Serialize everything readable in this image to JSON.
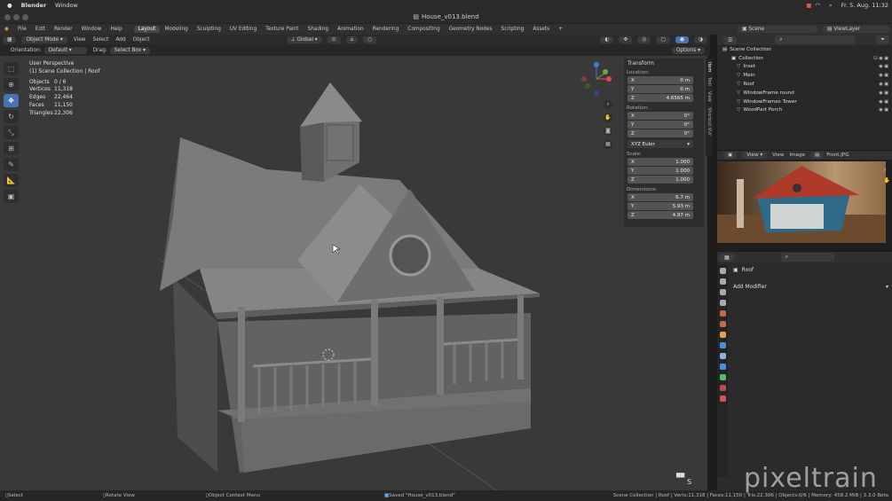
{
  "mac": {
    "app": "Blender",
    "menu_window": "Window",
    "date_time": "Fr. 5. Aug. 11:32"
  },
  "window": {
    "title": "House_v013.blend"
  },
  "menubar": {
    "items": [
      "File",
      "Edit",
      "Render",
      "Window",
      "Help"
    ],
    "tabs": [
      "Layout",
      "Modeling",
      "Sculpting",
      "UV Editing",
      "Texture Paint",
      "Shading",
      "Animation",
      "Rendering",
      "Compositing",
      "Geometry Nodes",
      "Scripting",
      "Assets"
    ],
    "add_tab": "+",
    "scene_label": "Scene",
    "viewlayer_label": "ViewLayer"
  },
  "viewport_header": {
    "mode": "Object Mode",
    "menus": [
      "View",
      "Select",
      "Add",
      "Object"
    ],
    "transform_orientation": "Global"
  },
  "tool_options": {
    "orientation_label": "Orientation:",
    "orientation_value": "Default",
    "drag_label": "Drag:",
    "drag_value": "Select Box",
    "options_label": "Options"
  },
  "viewport": {
    "title": "User Perspective",
    "collection": "(1) Scene Collection | Roof",
    "stats": [
      {
        "label": "Objects",
        "value": "0 / 6"
      },
      {
        "label": "Vertices",
        "value": "11,318"
      },
      {
        "label": "Edges",
        "value": "22,464"
      },
      {
        "label": "Faces",
        "value": "11,150"
      },
      {
        "label": "Triangles",
        "value": "22,306"
      }
    ],
    "corner_key": "S"
  },
  "npanel": {
    "title": "Transform",
    "location_label": "Location:",
    "location": [
      {
        "axis": "X",
        "value": "0 m"
      },
      {
        "axis": "Y",
        "value": "0 m"
      },
      {
        "axis": "Z",
        "value": "4.6565 m"
      }
    ],
    "rotation_label": "Rotation:",
    "rotation": [
      {
        "axis": "X",
        "value": "0°"
      },
      {
        "axis": "Y",
        "value": "0°"
      },
      {
        "axis": "Z",
        "value": "0°"
      }
    ],
    "rotation_mode": "XYZ Euler",
    "scale_label": "Scale:",
    "scale": [
      {
        "axis": "X",
        "value": "1.000"
      },
      {
        "axis": "Y",
        "value": "1.000"
      },
      {
        "axis": "Z",
        "value": "1.000"
      }
    ],
    "dimensions_label": "Dimensions:",
    "dimensions": [
      {
        "axis": "X",
        "value": "6.7 m"
      },
      {
        "axis": "Y",
        "value": "5.93 m"
      },
      {
        "axis": "Z",
        "value": "4.97 m"
      }
    ],
    "side_tabs": [
      "Item",
      "Tool",
      "View",
      "Shortcut VUr"
    ]
  },
  "outliner": {
    "root": "Scene Collection",
    "collection": "Collection",
    "items": [
      "Inset",
      "Main",
      "Roof",
      "WindowFrame round",
      "WindowFrames Tower",
      "WoodPart Porch"
    ]
  },
  "image_editor": {
    "menus": [
      "View",
      "View",
      "Image"
    ],
    "image_name": "Front.JPG"
  },
  "properties": {
    "object_name": "Roof",
    "add_modifier": "Add Modifier",
    "icon_colors": [
      "#aaaaaa",
      "#aaaaaa",
      "#aaaaaa",
      "#aaaaaa",
      "#c06a4a",
      "#c06a4a",
      "#e8a050",
      "#4a90e0",
      "#8fb0e0",
      "#4a90e0",
      "#55bb66",
      "#c04a4a",
      "#d05555"
    ]
  },
  "statusbar": {
    "select": "Select",
    "rotate": "Rotate View",
    "context": "Object Context Menu",
    "saved": "Saved \"House_v013.blend\"",
    "right": "Scene Collection | Roof | Verts:11,318 | Faces:11,150 | Tris:22,306 | Objects:0/6 | Memory: 458.2 MiB | 3.3.0 Beta"
  },
  "watermark": "pixeltrain"
}
